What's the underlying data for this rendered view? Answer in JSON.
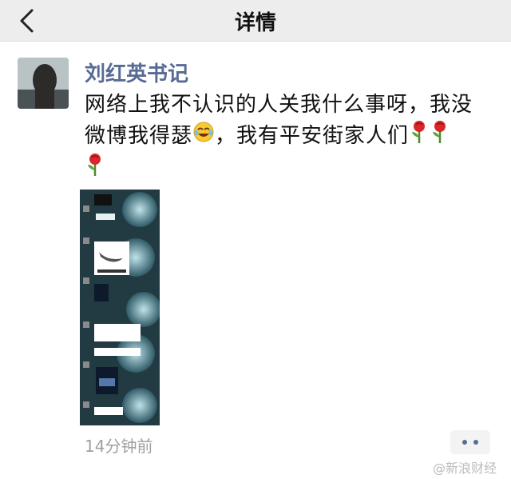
{
  "navbar": {
    "title": "详情"
  },
  "post": {
    "author": "刘红英书记",
    "text_part1": "网络上我不认识的人关我什么事呀，我没微博我得瑟",
    "text_part2": "，我有平安街家人们",
    "emojis": [
      "laugh-cry-icon",
      "rose-icon",
      "rose-icon",
      "rose-icon"
    ],
    "timestamp": "14分钟前"
  },
  "watermark": "@新浪财经"
}
